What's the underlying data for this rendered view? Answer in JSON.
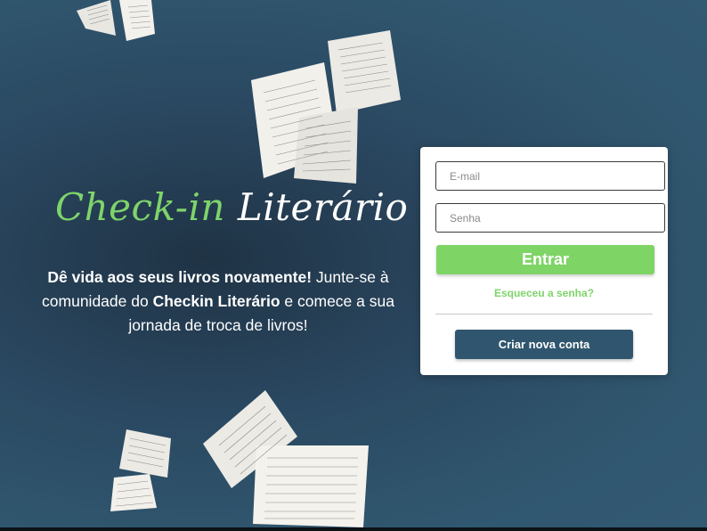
{
  "brand": {
    "part1": "Check-in",
    "part2": "Literário",
    "accent_color": "#7ed46a"
  },
  "hero": {
    "tagline_bold_1": "Dê vida aos seus livros novamente!",
    "tagline_text_1": " Junte-se à comunidade do ",
    "tagline_bold_2": "Checkin Literário",
    "tagline_text_2": " e comece a sua jornada de troca de livros!"
  },
  "login": {
    "email_placeholder": "E-mail",
    "password_placeholder": "Senha",
    "submit_label": "Entrar",
    "forgot_label": "Esqueceu a senha?",
    "create_account_label": "Criar nova conta",
    "submit_color": "#7fd466",
    "create_color": "#30566f"
  },
  "decor": {
    "icon": "flying-book-pages-icon"
  }
}
